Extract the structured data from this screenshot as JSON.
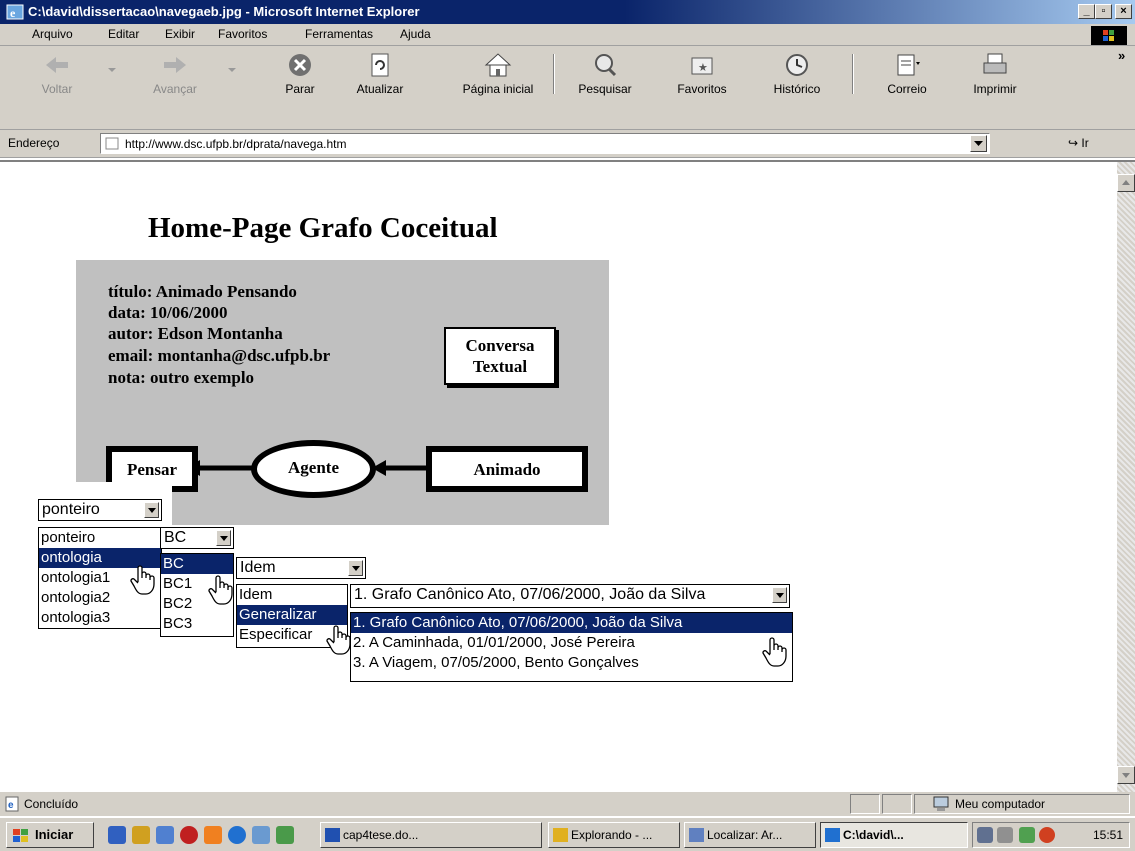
{
  "window": {
    "title": "C:\\david\\dissertacao\\navegaeb.jpg - Microsoft Internet Explorer"
  },
  "menu": [
    "Arquivo",
    "Editar",
    "Exibir",
    "Favoritos",
    "Ferramentas",
    "Ajuda"
  ],
  "toolbar": {
    "back": "Voltar",
    "forward": "Avançar",
    "stop": "Parar",
    "refresh": "Atualizar",
    "home": "Página inicial",
    "search": "Pesquisar",
    "favorites": "Favoritos",
    "history": "Histórico",
    "mail": "Correio",
    "print": "Imprimir",
    "more": "»"
  },
  "address": {
    "label": "Endereço",
    "url": "http://www.dsc.ufpb.br/dprata/navega.htm",
    "go": "Ir"
  },
  "page": {
    "title": "Home-Page Grafo Coceitual",
    "info": [
      "título: Animado Pensando",
      "data: 10/06/2000",
      "autor: Edson Montanha",
      "email: montanha@dsc.ufpb.br",
      "nota: outro exemplo"
    ],
    "button": {
      "line1": "Conversa",
      "line2": "Textual"
    },
    "graph": {
      "left": "Pensar",
      "center": "Agente",
      "right": "Animado"
    },
    "dropdown1": {
      "value": "ponteiro",
      "options": [
        "ponteiro",
        "ontologia",
        "ontologia1",
        "ontologia2",
        "ontologia3"
      ],
      "selected": 1
    },
    "dropdown2": {
      "value": "BC",
      "options": [
        "BC",
        "BC1",
        "BC2",
        "BC3"
      ],
      "selected": 0
    },
    "dropdown3": {
      "value": "Idem",
      "options": [
        "Idem",
        "Generalizar",
        "Especificar"
      ],
      "selected": 1
    },
    "dropdown4": {
      "value": "1. Grafo Canônico Ato, 07/06/2000, João da Silva",
      "options": [
        "1. Grafo Canônico Ato, 07/06/2000, João da Silva",
        "2. A Caminhada, 01/01/2000, José Pereira",
        "3. A Viagem, 07/05/2000, Bento Gonçalves"
      ],
      "selected": 0
    }
  },
  "status": {
    "text": "Concluído",
    "zone": "Meu computador"
  },
  "taskbar": {
    "start": "Iniciar",
    "tasks": [
      "cap4tese.do...",
      "Explorando - ...",
      "Localizar: Ar...",
      "C:\\david\\..."
    ],
    "clock": "15:51"
  },
  "colors": {
    "title_bar": "#0a246a",
    "face": "#d4d0c8",
    "panel_gray": "#c0c0c0",
    "selection": "#0a246a"
  }
}
